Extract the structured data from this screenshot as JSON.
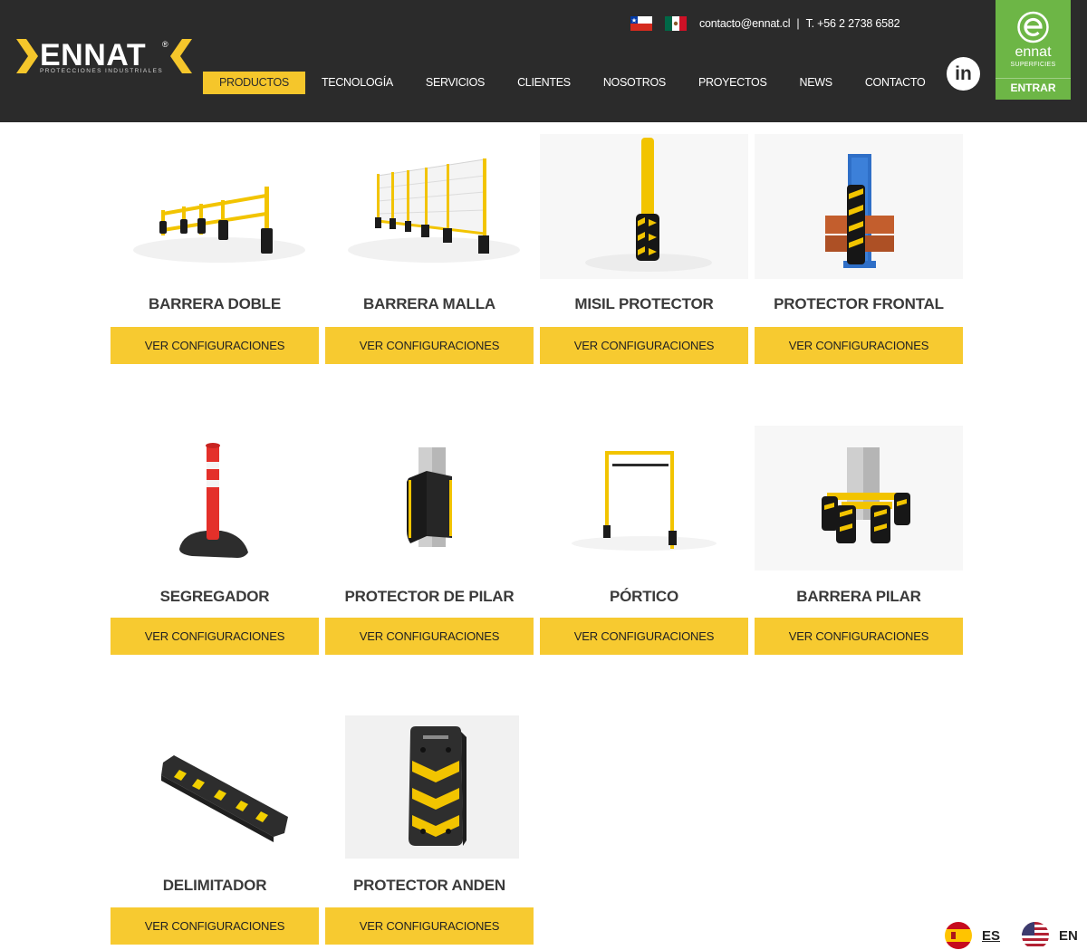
{
  "brand": {
    "name": "ENNAT",
    "tagline": "PROTECCIONES INDUSTRIALES",
    "accent_color": "#f5c62b",
    "header_color": "#2b2b2b"
  },
  "topbar": {
    "email": "contacto@ennat.cl",
    "phone": "T. +56 2 2738 6582"
  },
  "nav": [
    "PRODUCTOS",
    "TECNOLOGÍA",
    "SERVICIOS",
    "CLIENTES",
    "NOSOTROS",
    "PROYECTOS",
    "NEWS",
    "CONTACTO"
  ],
  "social": {
    "linkedin_label": "in"
  },
  "partner": {
    "name": "ennat",
    "sub": "SUPERFICIES",
    "cta": "ENTRAR",
    "color": "#6db646"
  },
  "products": [
    {
      "title": "BARRERA DOBLE",
      "button": "VER CONFIGURACIONES"
    },
    {
      "title": "BARRERA MALLA",
      "button": "VER CONFIGURACIONES"
    },
    {
      "title": "MISIL PROTECTOR",
      "button": "VER CONFIGURACIONES"
    },
    {
      "title": "PROTECTOR FRONTAL",
      "button": "VER CONFIGURACIONES"
    },
    {
      "title": "SEGREGADOR",
      "button": "VER CONFIGURACIONES"
    },
    {
      "title": "PROTECTOR DE PILAR",
      "button": "VER CONFIGURACIONES"
    },
    {
      "title": "PÓRTICO",
      "button": "VER CONFIGURACIONES"
    },
    {
      "title": "BARRERA PILAR",
      "button": "VER CONFIGURACIONES"
    },
    {
      "title": "DELIMITADOR",
      "button": "VER CONFIGURACIONES"
    },
    {
      "title": "PROTECTOR ANDEN",
      "button": "VER CONFIGURACIONES"
    }
  ],
  "languages": [
    {
      "code": "ES",
      "active": true
    },
    {
      "code": "EN",
      "active": false
    }
  ]
}
